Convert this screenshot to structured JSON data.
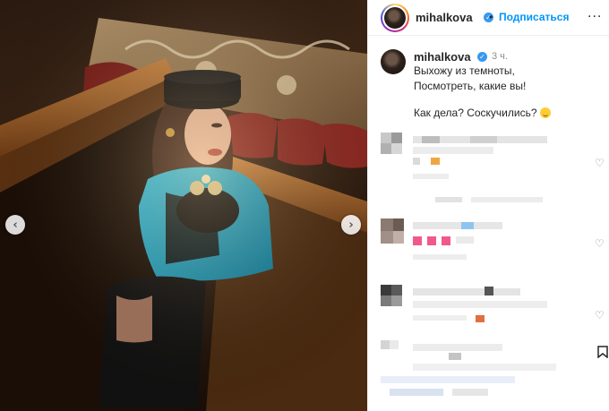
{
  "post": {
    "username": "mihalkova",
    "follow_label": "Подписаться",
    "separator": "•",
    "more_label": "...",
    "verified_mark": "✓",
    "caption": {
      "username": "mihalkova",
      "time": "3 ч.",
      "lines": [
        "Выхожу из темноты,",
        "Посмотреть, какие вы!",
        "Как дела? Соскучились?"
      ],
      "emoji": "smiling-face"
    },
    "nav": {
      "prev": "‹",
      "next": "›"
    },
    "icons": {
      "heart": "heart-outline-icon",
      "save": "bookmark-icon"
    },
    "colors": {
      "link": "#0095f6",
      "verified": "#3897f0",
      "text": "#262626",
      "muted": "#8e8e8e",
      "jacket": "#1aa0c2"
    }
  }
}
